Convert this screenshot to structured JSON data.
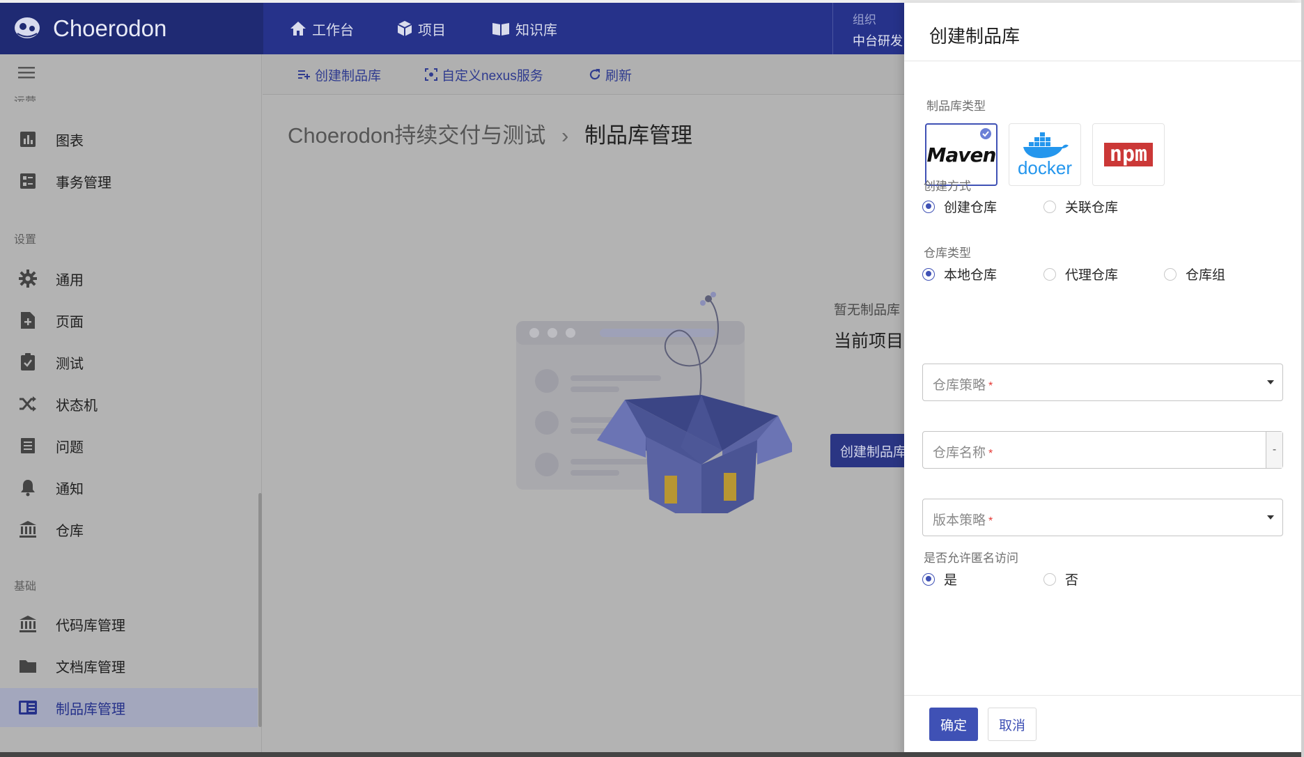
{
  "app": {
    "name": "Choerodon"
  },
  "topnav": {
    "workbench": "工作台",
    "project": "项目",
    "knowledge": "知识库",
    "org_label": "组织",
    "org_name": "中台研发"
  },
  "subnav": {
    "create_repo": "创建制品库",
    "custom_nexus": "自定义nexus服务",
    "refresh": "刷新"
  },
  "breadcrumb": {
    "parent": "Choerodon持续交付与测试",
    "separator": "›",
    "current": "制品库管理"
  },
  "sidebar": {
    "section_ops": "运营",
    "ops_items": [
      {
        "label": "图表",
        "icon": "bar-chart-icon"
      },
      {
        "label": "事务管理",
        "icon": "task-list-icon"
      }
    ],
    "section_settings": "设置",
    "settings_items": [
      {
        "label": "通用",
        "icon": "gear-icon"
      },
      {
        "label": "页面",
        "icon": "add-page-icon"
      },
      {
        "label": "测试",
        "icon": "clipboard-check-icon"
      },
      {
        "label": "状态机",
        "icon": "shuffle-icon"
      },
      {
        "label": "问题",
        "icon": "list-icon"
      },
      {
        "label": "通知",
        "icon": "bell-icon"
      },
      {
        "label": "仓库",
        "icon": "bank-icon"
      }
    ],
    "section_base": "基础",
    "base_items": [
      {
        "label": "代码库管理",
        "icon": "bank-icon"
      },
      {
        "label": "文档库管理",
        "icon": "folder-icon"
      },
      {
        "label": "制品库管理",
        "icon": "book-icon",
        "active": true
      }
    ]
  },
  "empty": {
    "title": "暂无制品库",
    "desc": "当前项目下",
    "button": "创建制品库"
  },
  "drawer": {
    "title": "创建制品库",
    "repo_type_label": "制品库类型",
    "repo_types": [
      "Maven",
      "docker",
      "npm"
    ],
    "create_mode_label": "创建方式",
    "create_modes": [
      "创建仓库",
      "关联仓库"
    ],
    "warehouse_type_label": "仓库类型",
    "warehouse_types": [
      "本地仓库",
      "代理仓库",
      "仓库组"
    ],
    "strategy_placeholder": "仓库策略",
    "name_placeholder": "仓库名称",
    "name_suffix": "-",
    "version_placeholder": "版本策略",
    "required_mark": "*",
    "anonymous_label": "是否允许匿名访问",
    "anonymous_options": [
      "是",
      "否"
    ],
    "confirm": "确定",
    "cancel": "取消"
  },
  "colors": {
    "primary": "#3f51b5",
    "header": "#26328a",
    "required": "#e53935"
  }
}
